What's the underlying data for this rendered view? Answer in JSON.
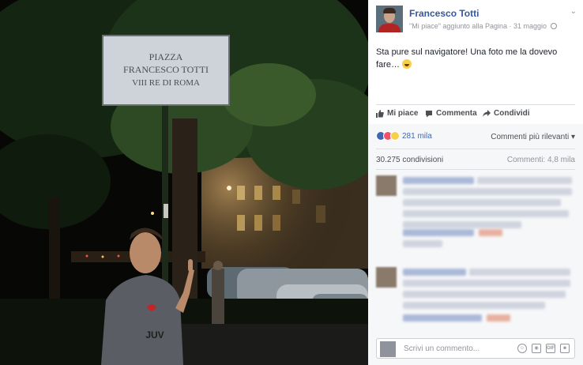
{
  "photo": {
    "sign": {
      "line1": "PIAZZA",
      "line2": "FRANCESCO TOTTI",
      "line3": "VIII RE DI ROMA"
    },
    "shirt_text": "JUV"
  },
  "post": {
    "page_name": "Francesco Totti",
    "meta_action": "\"Mi piace\" aggiunto alla Pagina",
    "meta_date": "31 maggio",
    "text_line1": "Sta pure sul navigatore! Una foto me la dovevo",
    "text_line2": "fare…",
    "chevron": "⌄"
  },
  "actions": {
    "like": "Mi piace",
    "comment": "Commenta",
    "share": "Condividi"
  },
  "stats": {
    "reactions_count": "281 mila",
    "sort_label": "Commenti più rilevanti",
    "shares": "30.275 condivisioni",
    "comments": "Commenti: 4,8 mila"
  },
  "composer": {
    "placeholder": "Scrivi un commento...",
    "gif_label": "GIF"
  },
  "colors": {
    "link": "#365899",
    "like_blue": "#4267b2",
    "love_red": "#f25268",
    "haha_yellow": "#f7d04b"
  },
  "icons": [
    "like-icon",
    "comment-icon",
    "share-icon",
    "globe-icon",
    "emoji-icon",
    "camera-icon",
    "gif-icon",
    "sticker-icon"
  ]
}
